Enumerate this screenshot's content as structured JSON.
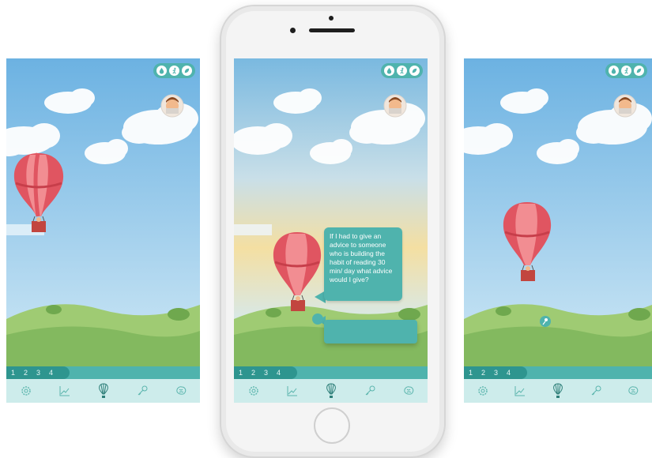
{
  "left_screen": {
    "progress_numbers": [
      "1",
      "2",
      "3",
      "4"
    ]
  },
  "center_screen": {
    "progress_numbers": [
      "1",
      "2",
      "3",
      "4"
    ],
    "advice_text": "If I had to give an advice to someone who is building the habit of reading 30 min/ day what advice would I give?"
  },
  "right_screen": {
    "progress_numbers": [
      "1",
      "2",
      "3",
      "4"
    ]
  },
  "top_icons": [
    "water-drop-icon",
    "running-person-icon",
    "leaf-icon"
  ],
  "bottom_nav_icons": [
    "gear-icon",
    "chart-icon",
    "balloon-icon",
    "key-icon",
    "brain-icon"
  ],
  "colors": {
    "teal": "#4fb3ad",
    "dark_teal": "#2e958f",
    "light_teal": "#cdeceb",
    "balloon_red": "#e05561",
    "balloon_pink": "#f28d92",
    "grass": "#8cc06a",
    "sky_top": "#6fb4e2",
    "sky_bottom": "#d6ecf7"
  }
}
